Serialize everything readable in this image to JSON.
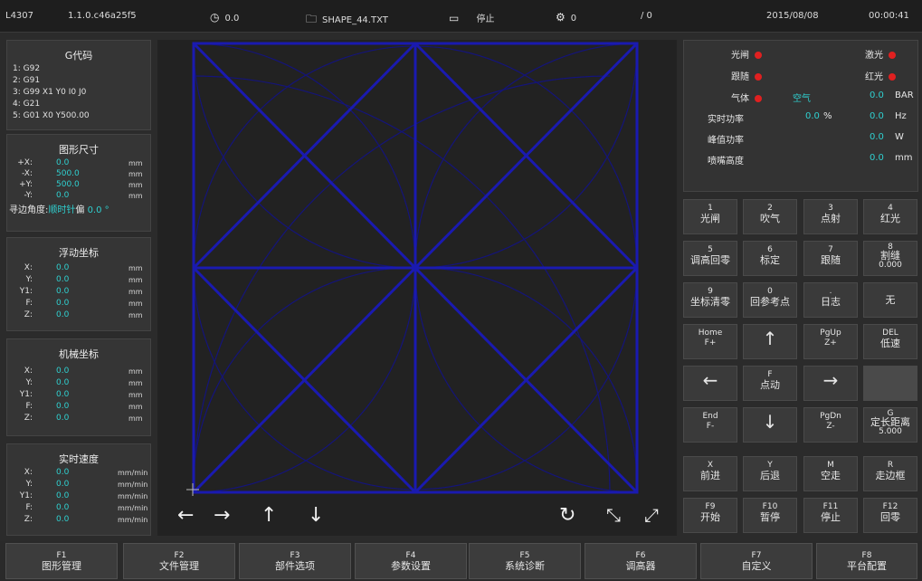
{
  "topbar": {
    "model": "L4307",
    "version": "1.1.0.c46a25f5",
    "speed": "0.0",
    "file": "SHAPE_44.TXT",
    "state": "停止",
    "count": "0",
    "count2": "/ 0",
    "date": "2015/08/08",
    "time": "00:00:41",
    "icons": [
      "gauge-icon",
      "folder-icon",
      "monitor-icon",
      "gear-icon"
    ]
  },
  "gcode": {
    "title": "G代码",
    "lines": [
      "1: G92",
      "2: G91",
      "3: G99 X1 Y0 I0 J0",
      "4: G21",
      "5: G01 X0 Y500.00"
    ]
  },
  "shape_size": {
    "title": "图形尺寸",
    "rows": [
      {
        "k": "+X:",
        "v": "0.0",
        "u": "mm"
      },
      {
        "k": "-X:",
        "v": "500.0",
        "u": "mm"
      },
      {
        "k": "+Y:",
        "v": "500.0",
        "u": "mm"
      },
      {
        "k": "-Y:",
        "v": "0.0",
        "u": "mm"
      }
    ],
    "edge_label": "寻边角度:",
    "edge_dir": "顺时针",
    "edge_suffix": "偏",
    "edge_value": "0.0 °"
  },
  "float_coord": {
    "title": "浮动坐标",
    "rows": [
      {
        "k": "X:",
        "v": "0.0",
        "u": "mm"
      },
      {
        "k": "Y:",
        "v": "0.0",
        "u": "mm"
      },
      {
        "k": "Y1:",
        "v": "0.0",
        "u": "mm"
      },
      {
        "k": "F:",
        "v": "0.0",
        "u": "mm"
      },
      {
        "k": "Z:",
        "v": "0.0",
        "u": "mm"
      }
    ]
  },
  "machine_coord": {
    "title": "机械坐标",
    "rows": [
      {
        "k": "X:",
        "v": "0.0",
        "u": "mm"
      },
      {
        "k": "Y:",
        "v": "0.0",
        "u": "mm"
      },
      {
        "k": "Y1:",
        "v": "0.0",
        "u": "mm"
      },
      {
        "k": "F:",
        "v": "0.0",
        "u": "mm"
      },
      {
        "k": "Z:",
        "v": "0.0",
        "u": "mm"
      }
    ]
  },
  "realtime_speed": {
    "title": "实时速度",
    "rows": [
      {
        "k": "X:",
        "v": "0.0",
        "u": "mm/min"
      },
      {
        "k": "Y:",
        "v": "0.0",
        "u": "mm/min"
      },
      {
        "k": "Y1:",
        "v": "0.0",
        "u": "mm/min"
      },
      {
        "k": "F:",
        "v": "0.0",
        "u": "mm/min"
      },
      {
        "k": "Z:",
        "v": "0.0",
        "u": "mm/min"
      }
    ]
  },
  "canvas_tools": {
    "left": "←",
    "right": "→",
    "up": "↑",
    "down": "↓",
    "refresh": "↻",
    "shrink": "⤡",
    "expand": "⤢"
  },
  "status": {
    "shutter": "光闸",
    "laser": "激光",
    "follow": "跟随",
    "red": "红光",
    "gas": "气体",
    "gas_type": "空气",
    "gas_value": "0.0",
    "gas_unit": "BAR",
    "power": "实时功率",
    "power_pct": "0.0",
    "power_pct_unit": "%",
    "power_hz": "0.0",
    "hz_unit": "Hz",
    "peak": "峰值功率",
    "peak_value": "0.0",
    "peak_unit": "W",
    "nozzle": "喷嘴高度",
    "nozzle_value": "0.0",
    "nozzle_unit": "mm",
    "indicator_color": "#e02020",
    "value_color": "#2fd0d0"
  },
  "keys": [
    {
      "s": "1",
      "b": "光闸"
    },
    {
      "s": "2",
      "b": "吹气"
    },
    {
      "s": "3",
      "b": "点射"
    },
    {
      "s": "4",
      "b": "红光"
    },
    {
      "s": "5",
      "b": "调高回零"
    },
    {
      "s": "6",
      "b": "标定"
    },
    {
      "s": "7",
      "b": "跟随"
    },
    {
      "s": "8",
      "b": "割缝",
      "x": "0.000"
    },
    {
      "s": "9",
      "b": "坐标清零"
    },
    {
      "s": "0",
      "b": "回参考点"
    },
    {
      "s": ".",
      "b": "日志"
    },
    {
      "s": "",
      "b": "无"
    },
    {
      "s": "Home",
      "b": "F+"
    },
    {
      "s": "",
      "big": "↑"
    },
    {
      "s": "PgUp",
      "b": "Z+"
    },
    {
      "s": "DEL",
      "b": "低速"
    },
    {
      "s": "",
      "big": "←"
    },
    {
      "s": "F",
      "b": "点动"
    },
    {
      "s": "",
      "big": "→"
    },
    {
      "s": "",
      "b": "",
      "blank": true
    },
    {
      "s": "End",
      "b": "F-"
    },
    {
      "s": "",
      "big": "↓"
    },
    {
      "s": "PgDn",
      "b": "Z-"
    },
    {
      "s": "G",
      "b": "定长距离",
      "x": "5.000"
    },
    {
      "s": "X",
      "b": "前进"
    },
    {
      "s": "Y",
      "b": "后退"
    },
    {
      "s": "M",
      "b": "空走"
    },
    {
      "s": "R",
      "b": "走边框"
    },
    {
      "s": "F9",
      "b": "开始"
    },
    {
      "s": "F10",
      "b": "暂停"
    },
    {
      "s": "F11",
      "b": "停止"
    },
    {
      "s": "F12",
      "b": "回零"
    }
  ],
  "fkeys": [
    {
      "n": "F1",
      "l": "图形管理"
    },
    {
      "n": "F2",
      "l": "文件管理"
    },
    {
      "n": "F3",
      "l": "部件选项"
    },
    {
      "n": "F4",
      "l": "参数设置"
    },
    {
      "n": "F5",
      "l": "系统诊断"
    },
    {
      "n": "F6",
      "l": "调高器"
    },
    {
      "n": "F7",
      "l": "自定义"
    },
    {
      "n": "F8",
      "l": "平台配置"
    }
  ],
  "colors": {
    "path": "#1a1ab0",
    "path_dim": "#14147a",
    "accent": "#2fd0d0",
    "indicator": "#e02020"
  }
}
